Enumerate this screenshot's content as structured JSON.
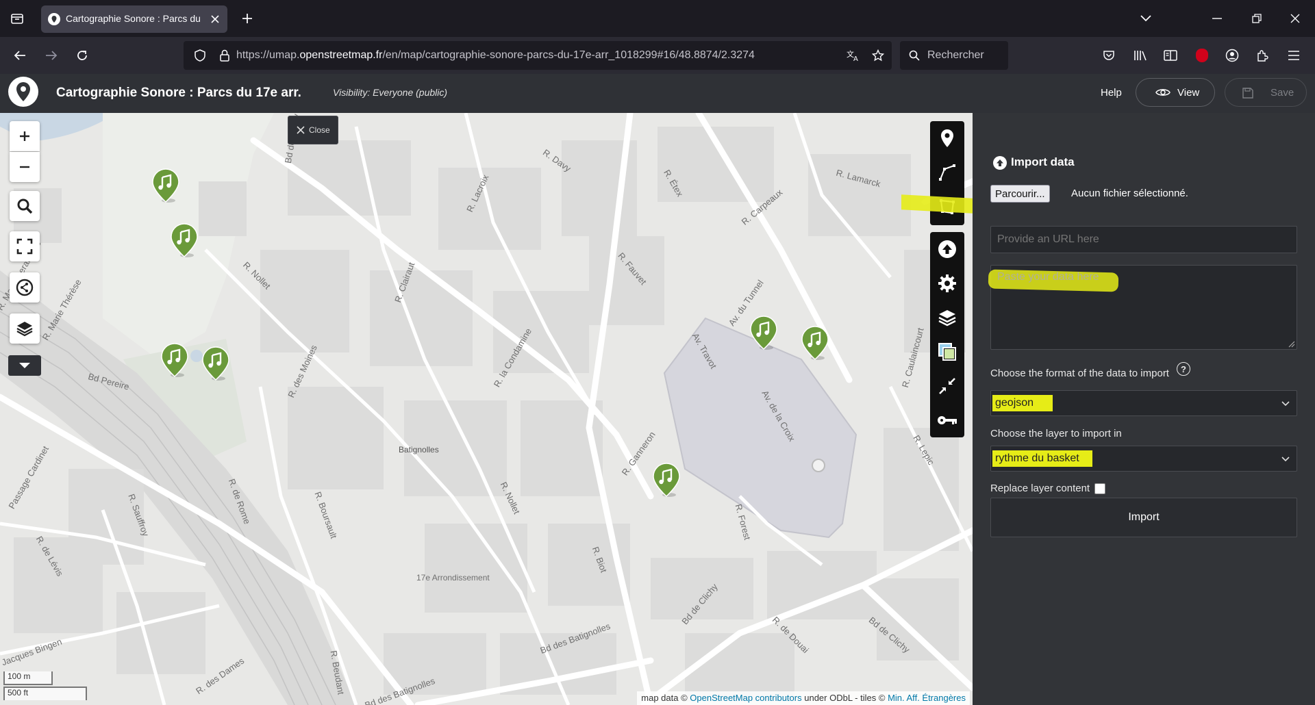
{
  "browser": {
    "tab_title": "Cartographie Sonore : Parcs du",
    "url_prefix": "https://umap.",
    "url_domain": "openstreetmap.fr",
    "url_path": "/en/map/cartographie-sonore-parcs-du-17e-arr_1018299#16/48.8874/2.3274",
    "search_label": "Rechercher"
  },
  "header": {
    "map_title": "Cartographie Sonore : Parcs du 17e arr.",
    "visibility": "Visibility: Everyone (public)",
    "help_label": "Help",
    "view_label": "View",
    "save_label": "Save"
  },
  "panel": {
    "close_label": "Close",
    "title": "Import data",
    "browse_label": "Parcourir...",
    "no_file": "Aucun fichier sélectionné.",
    "url_placeholder": "Provide an URL here",
    "paste_placeholder": "Paste your data here",
    "format_label": "Choose the format of the data to import",
    "format_value": "geojson",
    "layer_label": "Choose the layer to import in",
    "layer_value": "rythme du basket",
    "replace_label": "Replace layer content",
    "import_label": "Import"
  },
  "map": {
    "street_labels": [
      "R. Lamarck",
      "R. Davy",
      "R. Lacroix",
      "R. Étex",
      "R. Carpeaux",
      "R. Nollet",
      "R. Clairaut",
      "R. Fauvet",
      "Av. du Tunnel",
      "Av. Travot",
      "R. des Moines",
      "R. la Condamine",
      "Av. de la Croix",
      "R. Caulaincourt",
      "R. Lepic",
      "Bd Pereire",
      "Batignolles",
      "R. Ganneron",
      "R. Nollet",
      "R. Boursault",
      "R. de Rome",
      "R. Sauffroy",
      "R. de Lévis",
      "R. Biot",
      "R. Forest",
      "17e Arrondissement",
      "Bd de Clichy",
      "Bd de Clichy",
      "R. de Douai",
      "Bd des Batignolles",
      "Bd des Batignolles",
      "R. Beudant",
      "R. des Dames",
      "Jacques Bingen",
      "Passage Cardinet",
      "R. Marie Thérèse",
      "R. Maria Deraismes",
      "Bd de Clichy"
    ],
    "scale_metric": "100 m",
    "scale_imperial": "500 ft",
    "attribution_prefix": "map data ©",
    "attribution_osm": "OpenStreetMap contributors",
    "attribution_mid": "under ODbL - tiles ©",
    "attribution_tiles": "Min. Aff. Étrangères",
    "marker_count": 7
  },
  "colors": {
    "marker": "#6a9a3a",
    "highlight": "#e6ec17",
    "panel_bg": "#323438",
    "map_bg": "#e9e9e7"
  }
}
